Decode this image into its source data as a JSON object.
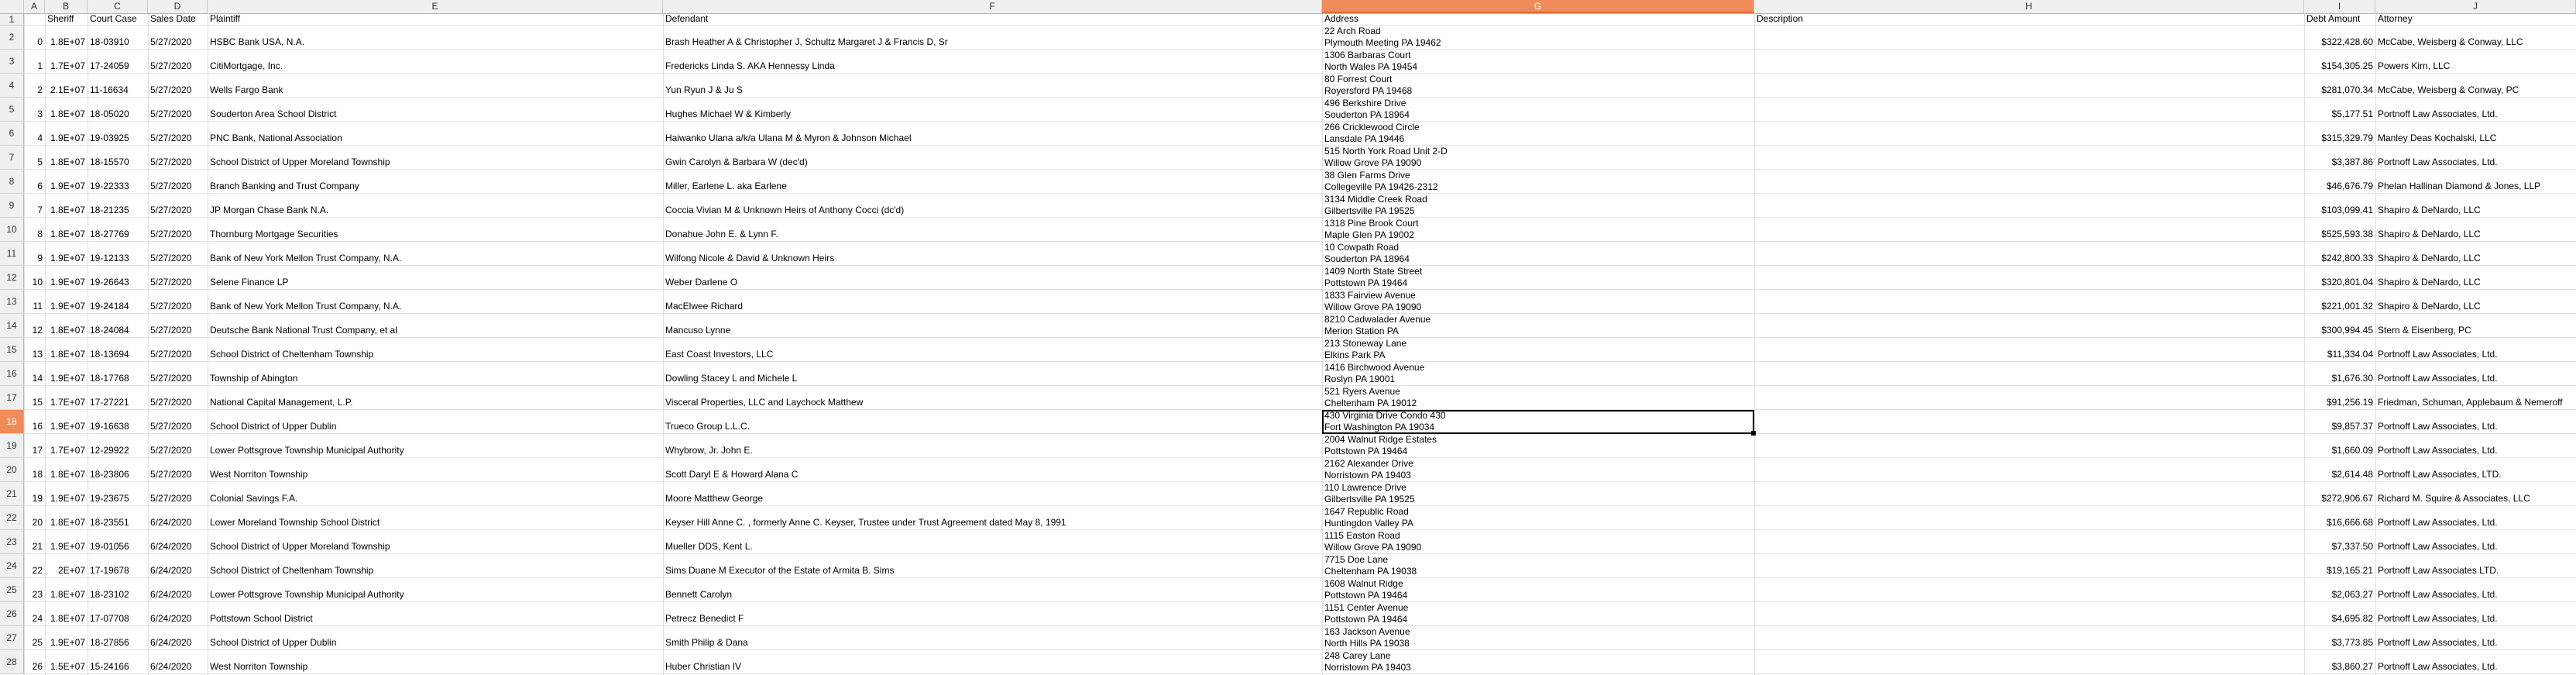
{
  "columns": [
    "A",
    "B",
    "C",
    "D",
    "E",
    "F",
    "G",
    "H",
    "I",
    "J"
  ],
  "active_column": "G",
  "active_row": "18",
  "header_row": {
    "row_number": "1",
    "cells": [
      "",
      "Sheriff",
      "Court Case",
      "Sales Date",
      "Plaintiff",
      "Defendant",
      "Address",
      "Description",
      "Debt Amount",
      "Attorney"
    ]
  },
  "rows": [
    {
      "n": "2",
      "a": "0",
      "b": "1.8E+07",
      "c": "18-03910",
      "d": "5/27/2020",
      "e": "HSBC Bank USA, N.A.",
      "f": "Brash Heather A & Christopher J, Schultz Margaret J & Francis D, Sr",
      "g1": "22 Arch Road",
      "g2": "Plymouth Meeting PA 19462",
      "i": "$322,428.60",
      "j": "McCabe, Weisberg & Conway, LLC"
    },
    {
      "n": "3",
      "a": "1",
      "b": "1.7E+07",
      "c": "17-24059",
      "d": "5/27/2020",
      "e": "CitiMortgage, Inc.",
      "f": "Fredericks Linda S. AKA Hennessy Linda",
      "g1": "1306 Barbaras Court",
      "g2": "North Wales PA 19454",
      "i": "$154,305.25",
      "j": "Powers Kirn, LLC"
    },
    {
      "n": "4",
      "a": "2",
      "b": "2.1E+07",
      "c": "11-16634",
      "d": "5/27/2020",
      "e": "Wells Fargo Bank",
      "f": "Yun Ryun J & Ju S",
      "g1": "80 Forrest Court",
      "g2": "Royersford PA 19468",
      "i": "$281,070.34",
      "j": "McCabe, Weisberg & Conway, PC"
    },
    {
      "n": "5",
      "a": "3",
      "b": "1.8E+07",
      "c": "18-05020",
      "d": "5/27/2020",
      "e": "Souderton Area School District",
      "f": "Hughes Michael W & Kimberly",
      "g1": "496 Berkshire Drive",
      "g2": "Souderton PA 18964",
      "i": "$5,177.51",
      "j": "Portnoff Law Associates, Ltd."
    },
    {
      "n": "6",
      "a": "4",
      "b": "1.9E+07",
      "c": "19-03925",
      "d": "5/27/2020",
      "e": "PNC Bank, National Association",
      "f": "Haiwanko Ulana a/k/a Ulana M & Myron & Johnson Michael",
      "g1": "266 Cricklewood Circle",
      "g2": "Lansdale PA 19446",
      "i": "$315,329.79",
      "j": "Manley Deas Kochalski, LLC"
    },
    {
      "n": "7",
      "a": "5",
      "b": "1.8E+07",
      "c": "18-15570",
      "d": "5/27/2020",
      "e": "School District of Upper Moreland Township",
      "f": "Gwin Carolyn & Barbara W (dec'd)",
      "g1": "515 North York Road Unit 2-D",
      "g2": "Willow Grove PA 19090",
      "i": "$3,387.86",
      "j": "Portnoff Law Associates, Ltd."
    },
    {
      "n": "8",
      "a": "6",
      "b": "1.9E+07",
      "c": "19-22333",
      "d": "5/27/2020",
      "e": "Branch Banking and Trust Company",
      "f": "Miller, Earlene L. aka Earlene",
      "g1": "38 Glen Farms Drive",
      "g2": "Collegeville PA 19426-2312",
      "i": "$46,676.79",
      "j": "Phelan Hallinan Diamond & Jones, LLP"
    },
    {
      "n": "9",
      "a": "7",
      "b": "1.8E+07",
      "c": "18-21235",
      "d": "5/27/2020",
      "e": "JP Morgan Chase Bank N.A.",
      "f": "Coccia Vivian M & Unknown Heirs of Anthony Cocci (dc'd)",
      "g1": "3134 Middle Creek Road",
      "g2": "Gilbertsville PA 19525",
      "i": "$103,099.41",
      "j": "Shapiro & DeNardo, LLC"
    },
    {
      "n": "10",
      "a": "8",
      "b": "1.8E+07",
      "c": "18-27769",
      "d": "5/27/2020",
      "e": "Thornburg Mortgage Securities",
      "f": "Donahue John E. & Lynn F.",
      "g1": "1318 Pine Brook Court",
      "g2": "Maple Glen PA 19002",
      "i": "$525,593.38",
      "j": "Shapiro & DeNardo, LLC"
    },
    {
      "n": "11",
      "a": "9",
      "b": "1.9E+07",
      "c": "19-12133",
      "d": "5/27/2020",
      "e": "Bank of New York Mellon Trust Company, N.A.",
      "f": "Wilfong Nicole & David & Unknown Heirs",
      "g1": "10 Cowpath Road",
      "g2": "Souderton PA 18964",
      "i": "$242,800.33",
      "j": "Shapiro & DeNardo, LLC"
    },
    {
      "n": "12",
      "a": "10",
      "b": "1.9E+07",
      "c": "19-26643",
      "d": "5/27/2020",
      "e": "Selene Finance LP",
      "f": "Weber Darlene O",
      "g1": "1409 North State Street",
      "g2": "Pottstown PA 19464",
      "i": "$320,801.04",
      "j": "Shapiro & DeNardo, LLC"
    },
    {
      "n": "13",
      "a": "11",
      "b": "1.9E+07",
      "c": "19-24184",
      "d": "5/27/2020",
      "e": "Bank of New York Mellon Trust Company, N.A.",
      "f": "MacElwee Richard",
      "g1": "1833 Fairview Avenue",
      "g2": "Willow Grove PA 19090",
      "i": "$221,001.32",
      "j": "Shapiro & DeNardo, LLC"
    },
    {
      "n": "14",
      "a": "12",
      "b": "1.8E+07",
      "c": "18-24084",
      "d": "5/27/2020",
      "e": "Deutsche Bank  National Trust Company, et al",
      "f": "Mancuso Lynne",
      "g1": "8210 Cadwalader Avenue",
      "g2": "Merion Station PA",
      "i": "$300,994.45",
      "j": "Stern & Eisenberg, PC"
    },
    {
      "n": "15",
      "a": "13",
      "b": "1.8E+07",
      "c": "18-13694",
      "d": "5/27/2020",
      "e": "School District of Cheltenham Township",
      "f": "East Coast Investors, LLC",
      "g1": "213 Stoneway Lane",
      "g2": "Elkins Park PA",
      "i": "$11,334.04",
      "j": "Portnoff Law Associates, Ltd."
    },
    {
      "n": "16",
      "a": "14",
      "b": "1.9E+07",
      "c": "18-17768",
      "d": "5/27/2020",
      "e": "Township of Abington",
      "f": "Dowling Stacey L and Michele L",
      "g1": "1416 Birchwood Avenue",
      "g2": "Roslyn PA 19001",
      "i": "$1,676.30",
      "j": "Portnoff Law Associates, Ltd."
    },
    {
      "n": "17",
      "a": "15",
      "b": "1.7E+07",
      "c": "17-27221",
      "d": "5/27/2020",
      "e": "National Capital Management, L.P.",
      "f": "Visceral Properties, LLC and Laychock Matthew",
      "g1": "521 Ryers Avenue",
      "g2": "Cheltenham PA 19012",
      "i": "$91,256.19",
      "j": "Friedman, Schuman, Applebaum & Nemeroff"
    },
    {
      "n": "18",
      "a": "16",
      "b": "1.9E+07",
      "c": "19-16638",
      "d": "5/27/2020",
      "e": "School District of Upper Dublin",
      "f": "Trueco Group L.L.C.",
      "g1": "430 Virginia Drive Condo 430",
      "g2": "Fort Washington PA 19034",
      "i": "$9,857.37",
      "j": "Portnoff Law Associates, Ltd."
    },
    {
      "n": "19",
      "a": "17",
      "b": "1.7E+07",
      "c": "12-29922",
      "d": "5/27/2020",
      "e": "Lower Pottsgrove Township Municipal Authority",
      "f": "Whybrow, Jr. John E.",
      "g1": "2004 Walnut Ridge Estates",
      "g2": "Pottstown PA 19464",
      "i": "$1,660.09",
      "j": "Portnoff Law Associates, Ltd."
    },
    {
      "n": "20",
      "a": "18",
      "b": "1.8E+07",
      "c": "18-23806",
      "d": "5/27/2020",
      "e": "West Norriton Township",
      "f": "Scott Daryl E & Howard Alana C",
      "g1": "2162 Alexander Drive",
      "g2": "Norristown PA 19403",
      "i": "$2,614.48",
      "j": "Portnoff Law Associates, LTD."
    },
    {
      "n": "21",
      "a": "19",
      "b": "1.9E+07",
      "c": "19-23675",
      "d": "5/27/2020",
      "e": "Colonial Savings F.A.",
      "f": "Moore Matthew George",
      "g1": "110 Lawrence Drive",
      "g2": "Gilbertsville PA 19525",
      "i": "$272,906.67",
      "j": "Richard M. Squire & Associates, LLC"
    },
    {
      "n": "22",
      "a": "20",
      "b": "1.8E+07",
      "c": "18-23551",
      "d": "6/24/2020",
      "e": "Lower Moreland Township School District",
      "f": "Keyser Hill Anne C. , formerly Anne C. Keyser, Trustee under Trust Agreement dated May 8, 1991",
      "g1": "1647 Republic Road",
      "g2": "Huntingdon Valley PA",
      "i": "$16,666.68",
      "j": "Portnoff Law Associates, Ltd."
    },
    {
      "n": "23",
      "a": "21",
      "b": "1.9E+07",
      "c": "19-01056",
      "d": "6/24/2020",
      "e": "School District of Upper Moreland Township",
      "f": "Mueller DDS, Kent L.",
      "g1": "1115 Easton Road",
      "g2": "Willow Grove PA 19090",
      "i": "$7,337.50",
      "j": "Portnoff Law Associates, Ltd."
    },
    {
      "n": "24",
      "a": "22",
      "b": "2E+07",
      "c": "17-19678",
      "d": "6/24/2020",
      "e": "School District of Cheltenham Township",
      "f": "Sims Duane M Executor of the Estate of Armita B. Sims",
      "g1": "7715 Doe Lane",
      "g2": "Cheltenham PA 19038",
      "i": "$19,165.21",
      "j": "Portnoff Law Associates LTD."
    },
    {
      "n": "25",
      "a": "23",
      "b": "1.8E+07",
      "c": "18-23102",
      "d": "6/24/2020",
      "e": "Lower Pottsgrove Township Municipal Authority",
      "f": "Bennett Carolyn",
      "g1": "1608 Walnut Ridge",
      "g2": "Pottstown PA 19464",
      "i": "$2,063.27",
      "j": "Portnoff Law Associates, Ltd."
    },
    {
      "n": "26",
      "a": "24",
      "b": "1.8E+07",
      "c": "17-07708",
      "d": "6/24/2020",
      "e": "Pottstown School District",
      "f": "Petrecz Benedict F",
      "g1": "1151 Center Avenue",
      "g2": "Pottstown PA 19464",
      "i": "$4,695.82",
      "j": "Portnoff Law Associates, Ltd."
    },
    {
      "n": "27",
      "a": "25",
      "b": "1.9E+07",
      "c": "18-27856",
      "d": "6/24/2020",
      "e": "School District of Upper Dublin",
      "f": "Smith Philip & Dana",
      "g1": "163 Jackson Avenue",
      "g2": "North Hills PA 19038",
      "i": "$3,773.85",
      "j": "Portnoff Law Associates, Ltd."
    },
    {
      "n": "28",
      "a": "26",
      "b": "1.5E+07",
      "c": "15-24166",
      "d": "6/24/2020",
      "e": "West Norriton Township",
      "f": "Huber Christian IV",
      "g1": "248 Carey Lane",
      "g2": "Norristown PA 19403",
      "i": "$3,860.27",
      "j": "Portnoff Law Associates, Ltd."
    }
  ]
}
